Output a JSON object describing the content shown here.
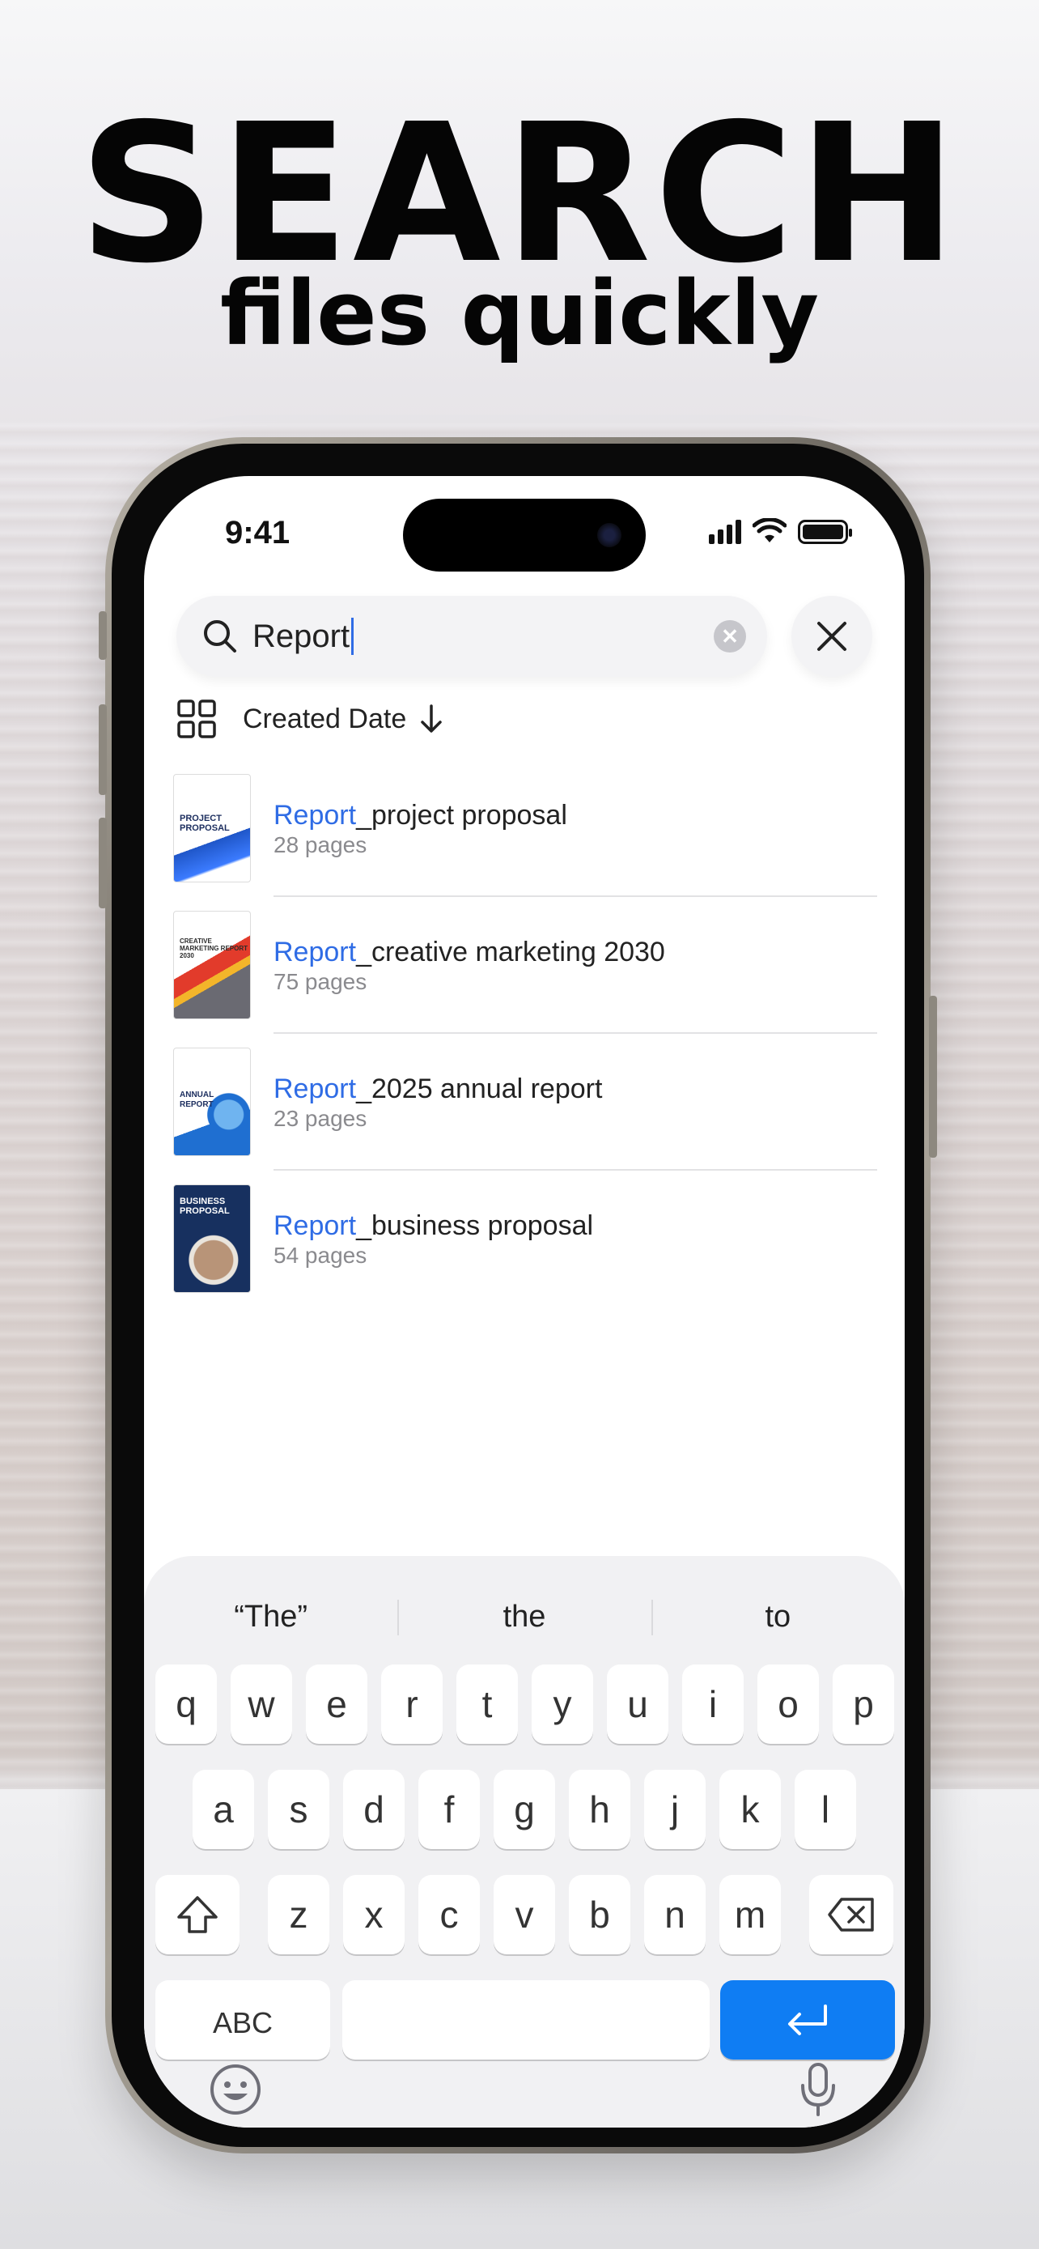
{
  "headline": "SEARCH",
  "subheadline": "files quickly",
  "status_bar": {
    "time": "9:41"
  },
  "search": {
    "value": "Report",
    "clear_icon": "clear-circle-icon",
    "close_icon": "close-x-icon"
  },
  "sort": {
    "label": "Created Date",
    "direction_icon": "arrow-down-icon",
    "view_icon": "grid-icon"
  },
  "files": [
    {
      "highlight": "Report",
      "rest": "_project proposal",
      "pages": "28 pages",
      "thumb_title": "PROJECT PROPOSAL",
      "thumb_color": "#1f56c8"
    },
    {
      "highlight": "Report",
      "rest": "_creative marketing 2030",
      "pages": "75 pages",
      "thumb_title": "CREATIVE MARKETING REPORT 2030",
      "thumb_color": "#d92b2b"
    },
    {
      "highlight": "Report",
      "rest": "_2025 annual report",
      "pages": "23 pages",
      "thumb_title": "ANNUAL REPORT",
      "thumb_color": "#1f6fd1"
    },
    {
      "highlight": "Report",
      "rest": "_business proposal",
      "pages": "54 pages",
      "thumb_title": "BUSINESS PROPOSAL",
      "thumb_color": "#17305f"
    }
  ],
  "keyboard": {
    "suggestions": [
      "“The”",
      "the",
      "to"
    ],
    "row1": [
      "q",
      "w",
      "e",
      "r",
      "t",
      "y",
      "u",
      "i",
      "o",
      "p"
    ],
    "row2": [
      "a",
      "s",
      "d",
      "f",
      "g",
      "h",
      "j",
      "k",
      "l"
    ],
    "row3": [
      "z",
      "x",
      "c",
      "v",
      "b",
      "n",
      "m"
    ],
    "abc_label": "ABC",
    "return_color": "#0f7df3"
  },
  "colors": {
    "accent": "#2f6ce5"
  }
}
